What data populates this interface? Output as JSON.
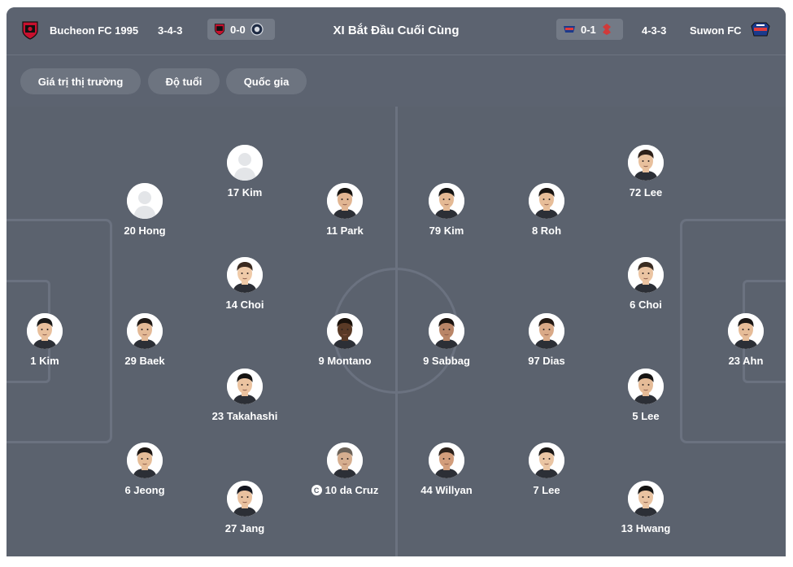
{
  "header": {
    "title": "XI Bắt Đầu Cuối Cùng",
    "home": {
      "name": "Bucheon FC 1995",
      "formation": "3-4-3",
      "score": "0-0",
      "crest_color": "#c8102e"
    },
    "away": {
      "name": "Suwon FC",
      "formation": "4-3-3",
      "score": "0-1",
      "crest_color": "#1b3a8c"
    }
  },
  "filters": [
    "Giá trị thị trường",
    "Độ tuổi",
    "Quốc gia"
  ],
  "colors": {
    "panel": "#5c6370",
    "pitch": "#5b626e",
    "line": "#6b7280",
    "chip": "#6d7480"
  },
  "home_players": [
    {
      "id": "p1",
      "label": "1 Kim",
      "photo": true,
      "skin": "#e8bf9c",
      "hair": "#1a1a1a"
    },
    {
      "id": "p2",
      "label": "20 Hong",
      "photo": false
    },
    {
      "id": "p3",
      "label": "29 Baek",
      "photo": true,
      "skin": "#e3b996",
      "hair": "#201a17"
    },
    {
      "id": "p4",
      "label": "6 Jeong",
      "photo": true,
      "skin": "#e6bd98",
      "hair": "#1c1714"
    },
    {
      "id": "p5",
      "label": "17 Kim",
      "photo": false
    },
    {
      "id": "p6",
      "label": "14 Choi",
      "photo": true,
      "skin": "#efcaa8",
      "hair": "#3a2a20"
    },
    {
      "id": "p7",
      "label": "23 Takahashi",
      "photo": true,
      "skin": "#ebc3a0",
      "hair": "#151312"
    },
    {
      "id": "p8",
      "label": "27 Jang",
      "photo": true,
      "skin": "#e9c19f",
      "hair": "#14161f"
    },
    {
      "id": "p9",
      "label": "11 Park",
      "photo": true,
      "skin": "#e1b592",
      "hair": "#161412"
    },
    {
      "id": "p10",
      "label": "9 Montano",
      "photo": true,
      "skin": "#5a3a26",
      "hair": "#1a120c"
    },
    {
      "id": "p11",
      "label": "10 da Cruz",
      "photo": true,
      "skin": "#d6ae8f",
      "hair": "#6b6259",
      "captain": true
    }
  ],
  "away_players": [
    {
      "id": "a1",
      "label": "79 Kim",
      "photo": true,
      "skin": "#e4b994",
      "hair": "#151515"
    },
    {
      "id": "a2",
      "label": "9 Sabbag",
      "photo": true,
      "skin": "#b98567",
      "hair": "#1b1410"
    },
    {
      "id": "a3",
      "label": "44 Willyan",
      "photo": true,
      "skin": "#d29d7b",
      "hair": "#2b211b"
    },
    {
      "id": "a4",
      "label": "8 Roh",
      "photo": true,
      "skin": "#e7bd98",
      "hair": "#1a1512"
    },
    {
      "id": "a5",
      "label": "97 Dias",
      "photo": true,
      "skin": "#d9a987",
      "hair": "#241a14"
    },
    {
      "id": "a6",
      "label": "7 Lee",
      "photo": true,
      "skin": "#eac5a3",
      "hair": "#1b1816"
    },
    {
      "id": "a7",
      "label": "72 Lee",
      "photo": true,
      "skin": "#e8c09d",
      "hair": "#2e211a"
    },
    {
      "id": "a8",
      "label": "6 Choi",
      "photo": true,
      "skin": "#ebc4a2",
      "hair": "#3a2c22"
    },
    {
      "id": "a9",
      "label": "5 Lee",
      "photo": true,
      "skin": "#e5bb97",
      "hair": "#171514"
    },
    {
      "id": "a10",
      "label": "13 Hwang",
      "photo": true,
      "skin": "#e9c3a1",
      "hair": "#151413"
    },
    {
      "id": "a11",
      "label": "23 Ahn",
      "photo": true,
      "skin": "#e6bc98",
      "hair": "#1a1716"
    }
  ],
  "icons": {
    "captain": "C"
  }
}
